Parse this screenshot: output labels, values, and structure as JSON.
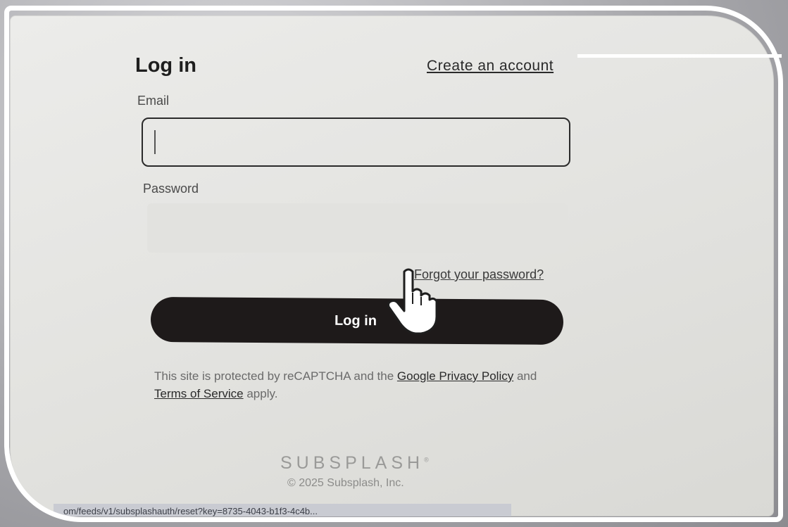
{
  "header": {
    "title": "Log in",
    "create_account_link": "Create an account"
  },
  "form": {
    "email_label": "Email",
    "email_value": "",
    "password_label": "Password",
    "password_value": "",
    "forgot_password_link": "Forgot your password?",
    "login_button": "Log in"
  },
  "recaptcha": {
    "text_before": "This site is protected by reCAPTCHA and the",
    "privacy_link": "Google Privacy Policy",
    "and_text": "and",
    "terms_link": "Terms of Service",
    "text_after": "apply."
  },
  "footer": {
    "brand": "SUBSPLASH",
    "brand_mark": "®",
    "copyright": "© 2025 Subsplash, Inc."
  },
  "status_bar": {
    "url": "om/feeds/v1/subsplashauth/reset?key=8735-4043-b1f3-4c4b..."
  },
  "colors": {
    "button_bg": "#1e1a1a",
    "button_text": "#ffffff",
    "page_bg": "#e7e7e4"
  },
  "icons": {
    "cursor": "hand-pointer-icon"
  }
}
